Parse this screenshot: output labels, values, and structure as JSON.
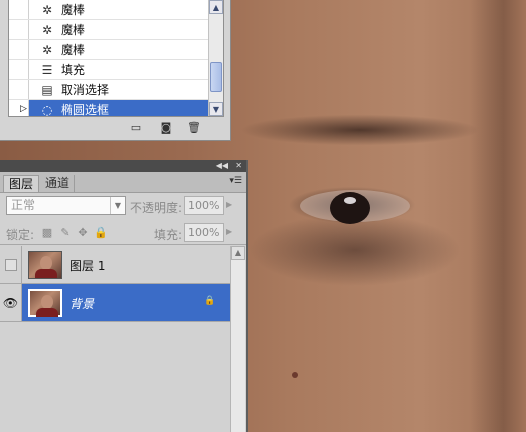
{
  "history": {
    "items": [
      {
        "label": "魔棒",
        "icon": "magic-wand-icon",
        "glyph": "✲",
        "selected": false
      },
      {
        "label": "魔棒",
        "icon": "magic-wand-icon",
        "glyph": "✲",
        "selected": false
      },
      {
        "label": "魔棒",
        "icon": "magic-wand-icon",
        "glyph": "✲",
        "selected": false
      },
      {
        "label": "填充",
        "icon": "fill-icon",
        "glyph": "☰",
        "selected": false
      },
      {
        "label": "取消选择",
        "icon": "deselect-icon",
        "glyph": "▤",
        "selected": false
      },
      {
        "label": "椭圆选框",
        "icon": "elliptical-marquee-icon",
        "glyph": "◌",
        "selected": true
      }
    ],
    "footer_icons": [
      "new-document-from-state-icon",
      "snapshot-camera-icon",
      "trash-icon"
    ]
  },
  "layers": {
    "tabs": [
      {
        "label": "图层",
        "active": true
      },
      {
        "label": "通道",
        "active": false
      }
    ],
    "blend_mode": "正常",
    "opacity_label": "不透明度:",
    "opacity_value": "100%",
    "lock_label": "锁定:",
    "fill_label": "填充:",
    "fill_value": "100%",
    "rows": [
      {
        "name": "图层 1",
        "visible": false,
        "selected": false,
        "locked": false
      },
      {
        "name": "背景",
        "visible": true,
        "selected": true,
        "locked": true
      }
    ]
  },
  "colors": {
    "selection": "#3b6cc7",
    "panel": "#d2d2d2",
    "titlebar": "#4b4b4b"
  }
}
